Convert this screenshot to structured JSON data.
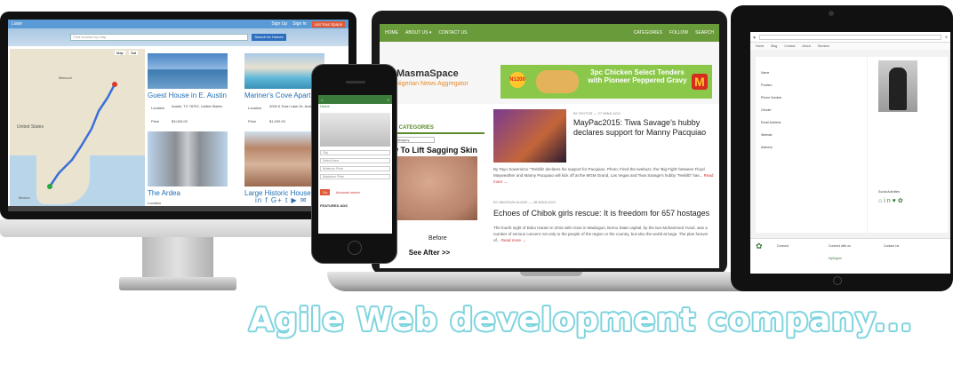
{
  "listing_site": {
    "brand": "Lister",
    "nav": [
      "Sign Up",
      "Sign In"
    ],
    "cta": "List Your Space",
    "search_placeholder": "Find location by map",
    "search_button": "Search for Homes",
    "listings": [
      {
        "title": "Guest House in E. Austin",
        "location_label": "Location",
        "location": "Austin, TX 78702, United States",
        "price_label": "Price",
        "price": "$3,000.00"
      },
      {
        "title": "Mariner's Cove Apart...",
        "location_label": "Location",
        "location": "4000 A Town Lake Dr, Austin",
        "price_label": "Price",
        "price": "$1,200.00"
      },
      {
        "title": "The Ardea",
        "location_label": "Location",
        "location": "",
        "price_label": "",
        "price": ""
      },
      {
        "title": "Large Historic House",
        "location_label": "Location",
        "location": "",
        "price_label": "",
        "price": ""
      }
    ],
    "social": "in f G+ t ▶ ✉",
    "map_labels": {
      "missouri": "Missouri",
      "united_states": "United States",
      "mexico": "Mexico"
    },
    "map_zoom": [
      "Map",
      "Sat"
    ]
  },
  "news_site": {
    "nav": [
      "HOME",
      "ABOUT US ▾",
      "CONTACT US"
    ],
    "nav_right": [
      "CATEGORIES",
      "FOLLOW",
      "SEARCH"
    ],
    "logo": "MasmaSpace",
    "logo_tagline": "Nigerian News Aggregator",
    "ad": {
      "text": "3pc Chicken Select Tenders with Pioneer Peppered Gravy",
      "badge": "N1200",
      "logo": "M"
    },
    "sidebar": {
      "title": "NEWS CATEGORIES",
      "select": "Select Category",
      "promo_title": "How To Lift Sagging Skin",
      "promo_before": "Before",
      "promo_after": "See After >>"
    },
    "posts": [
      {
        "meta": "BY EDITOR — 27 MINS AGO",
        "title": "MayPac2015: Tiwa Savage's hubby declares support for Manny Pacquiao",
        "body": "By Tayo Sowemimo \"Teebillz declares his support for Pacquiao. Photo: Fired the Iwebuzz, the 'Big Fight' between Floyd Mayweather and Manny Pacquiao will kick off at the MGM Grand, Las Vegas and Tiwa Savage's hubby 'Teebillz' has...",
        "more": "Read more →"
      },
      {
        "meta": "BY ABIODUN ALADE — 48 MINS AGO",
        "title": "Echoes of Chibok girls rescue: It is freedom for 657 hostages",
        "body": "The fourth night of Boko Haram in 2015 with close in Maiduguri, Borno State capital, by the two Mohammed Yusuf, was a number of serious concern not only to the people of the region or the country, but also the world at large. The plan forever of...",
        "more": "Read more →"
      }
    ]
  },
  "phone_site": {
    "menu": "≡",
    "sub": "Home",
    "fields": [
      "City",
      "Select Area",
      "Minimum Price",
      "Maximum Price"
    ],
    "button": "Go",
    "button_alt": "Advanced search",
    "featured": "FEATURED ADS"
  },
  "tablet_site": {
    "rows": [
      "Name",
      "Position",
      "Phone Number",
      "Gender",
      "Email Address",
      "Website",
      "Address"
    ],
    "links": [
      "Home",
      "Blog",
      "Contact",
      "About",
      "Services"
    ],
    "profile_caption": "Social Activities",
    "footer": [
      "Connect",
      "Connect with us",
      "Contact Us"
    ],
    "footer_brand": "MyDigest"
  },
  "tagline": "Agile Web development company..."
}
